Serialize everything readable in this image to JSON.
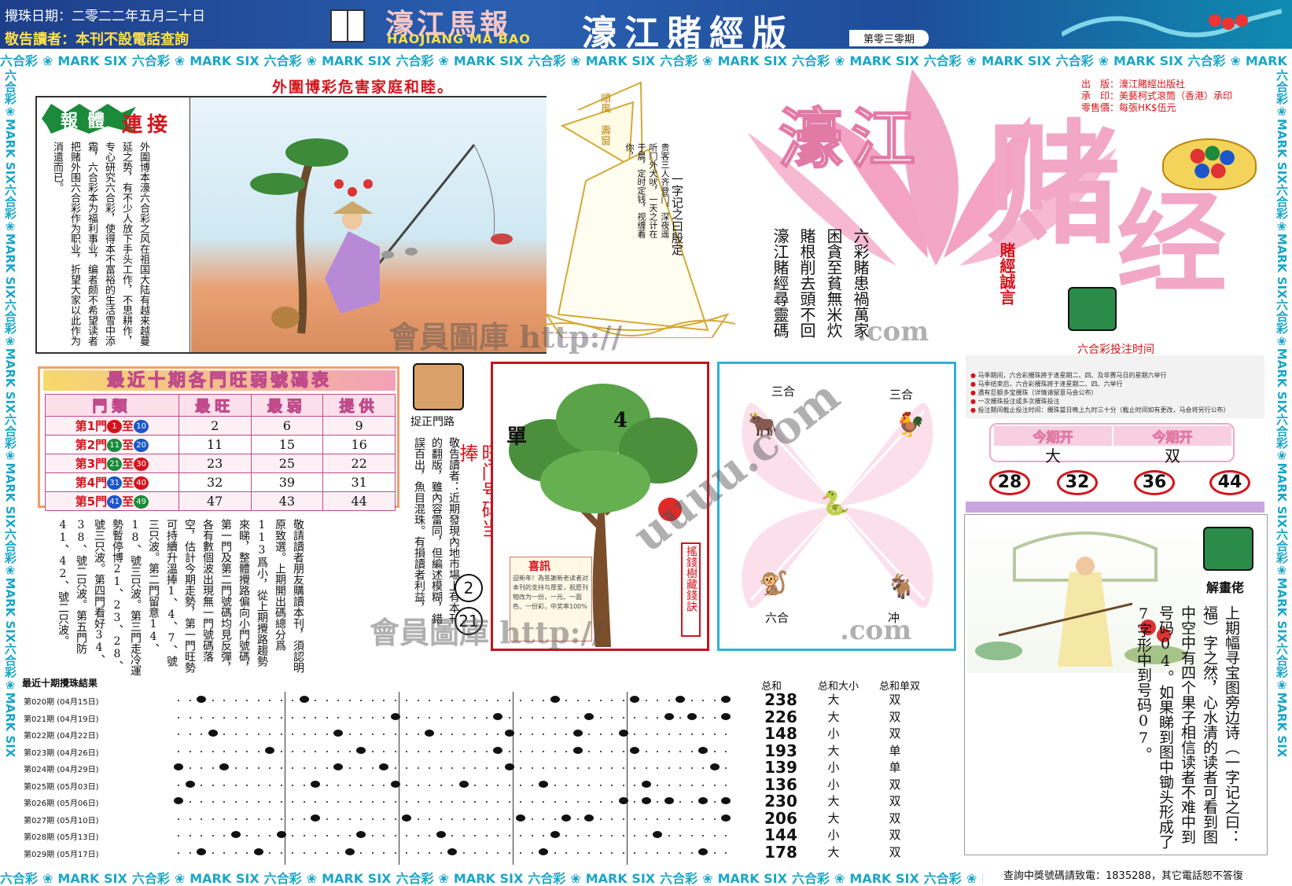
{
  "header": {
    "date": "攪珠日期：二零二二年五月二十日",
    "notice": "敬告讀者：本刊不設電話查詢",
    "logo": "濠江馬報",
    "logo_en": "HAOJIANG MA BAO",
    "edition": "濠江賭經版",
    "issue": "第零三零期"
  },
  "band": {
    "unit_cn": "六合彩",
    "unit_en": "MARK SIX"
  },
  "headline": "外圍博彩危害家庭和睦。",
  "cartoon": {
    "title_a": "報體",
    "title_b": "連接",
    "body": "外圍博本濠六合彩之风在祖国大陆有越来越蔓延之势，有不少人放下手头工作，不思耕作，专心研究六合彩，使得本不富裕的生活雪中添霜，六合彩本为福利事业，编者颇不希望读者把赌外围六合彩作为职业，折望大家以此作为消遣而已。"
  },
  "boat": {
    "sail": "順風\n壽窗",
    "sail_verse": "贵客三人齐登门。深夜遥听门外犬吠，一天之计在于晨，定时定钱，视缠着你，",
    "poem": "一字记之曰殷定"
  },
  "brand": {
    "big1": "濠江",
    "big2": "赌",
    "big3": "经",
    "motto": "賭經誠言",
    "verse": [
      "六彩賭患禍萬家",
      "困貪至貧無米炊",
      "賭根削去頭不回",
      "濠江賭經尋靈碼"
    ],
    "pub_lines": [
      "出　版：濠江賭經出版社",
      "承　印：美藝柯式滾筒（香港）承印",
      "零售價：每張HK$伍元"
    ],
    "schedule_title": "六合彩投注时间"
  },
  "schedule_notes": [
    "马季期间，六合彩攪珠將于逢星期二、四、及非赛马日的星期六举行",
    "马季结束后，六合彩攪珠將于逢星期二、四、六举行",
    "遇有巨额多宝攪珠（详情请留意马会公布）",
    "一次攪珠投注或多次攪珠投注",
    "投注期间截止投注时间：攪珠當日晚上九时三十分（截止时间如有更改，马会将另行公布）"
  ],
  "open": {
    "label": "今期开",
    "left": "大",
    "right": "双",
    "numbers": [
      "28",
      "32",
      "36",
      "44"
    ]
  },
  "ten_table": {
    "title": "最近十期各門旺弱號碼表",
    "headers": [
      "門類",
      "最旺",
      "最弱",
      "提供"
    ],
    "to": "至",
    "rows": [
      {
        "gate": "第1門",
        "from": "1",
        "from_c": "#d4141c",
        "end": "10",
        "end_c": "#1c56c8",
        "hot": "2",
        "cold": "6",
        "pick": "9"
      },
      {
        "gate": "第2門",
        "from": "11",
        "from_c": "#1b8a3a",
        "end": "20",
        "end_c": "#1c56c8",
        "hot": "11",
        "cold": "15",
        "pick": "16"
      },
      {
        "gate": "第3門",
        "from": "21",
        "from_c": "#1b8a3a",
        "end": "30",
        "end_c": "#d4141c",
        "hot": "23",
        "cold": "25",
        "pick": "22"
      },
      {
        "gate": "第4門",
        "from": "31",
        "from_c": "#1c56c8",
        "end": "40",
        "end_c": "#d4141c",
        "hot": "32",
        "cold": "39",
        "pick": "31"
      },
      {
        "gate": "第5門",
        "from": "41",
        "from_c": "#1c56c8",
        "end": "49",
        "end_c": "#1b8a3a",
        "hot": "47",
        "cold": "43",
        "pick": "44"
      }
    ]
  },
  "gate_pick": {
    "label": "捉正門路",
    "note": "敬告讀者：近期發現內地市場上有本刊的翻版，雖內容雷同，但編述模糊，錯誤百出，魚目混珠。有損讀者利益，",
    "title": "旺门号码当捧",
    "n1": "2",
    "n2": "21"
  },
  "analysis": "敬請讀者朋友購讀本刊，須認明原致選。上期開出碼總分爲113爲小，從上期攪路趨勢來睇，整體攪路偏向小門號碼，第一門及第二門號碼均見反彈，各有數個波出現無一門號碼落空，估計今期走勢，第一門旺勢可持續升溫捧1、4、7、號三只波。第二門留意14、18、號三只波。第三門走冷運勢暫停博21、23、28、號三只波。第四門看好34、38、號二只波。第五門防41、42、號二只波。",
  "tree": {
    "single": "單",
    "four": "4",
    "label": "搖錢樹藏錢訣",
    "joy_title": "喜訊",
    "joy_body": "迎新年！為答謝新老读者对本刊的支持与厚爱，祝愿刊物改为一份，一元、一面色、一份彩，中奖率100%"
  },
  "zodiac": {
    "tl": "三合",
    "tr": "三合",
    "bl": "六合",
    "br": "冲"
  },
  "painting": {
    "label": "解畫佬",
    "body": "上期幅寻宝图旁边诗（一字记之曰：福）字之然，心水清的读者可看到图中空中有四个果子相信读者不难中到号码04。如果睇到图中锄头形成了7字形中到号码07。"
  },
  "results": {
    "title": "最近十期攪珠結果",
    "sum_hdr": "总和",
    "size_hdr": "总和大小",
    "oe_hdr": "总和单双",
    "rows": [
      {
        "label": "第020期 (04月15日)",
        "sum": "238",
        "size": "大",
        "oe": "双",
        "dots": [
          3,
          34,
          41,
          45,
          49,
          12
        ]
      },
      {
        "label": "第021期 (04月19日)",
        "sum": "226",
        "size": "大",
        "oe": "双",
        "dots": [
          20,
          29,
          37,
          44,
          46,
          49
        ]
      },
      {
        "label": "第022期 (04月22日)",
        "sum": "148",
        "size": "小",
        "oe": "双",
        "dots": [
          4,
          15,
          23,
          30,
          36,
          40
        ]
      },
      {
        "label": "第023期 (04月26日)",
        "sum": "193",
        "size": "大",
        "oe": "单",
        "dots": [
          9,
          17,
          29,
          36,
          41,
          47
        ]
      },
      {
        "label": "第024期 (04月29日)",
        "sum": "139",
        "size": "小",
        "oe": "单",
        "dots": [
          1,
          5,
          15,
          19,
          30,
          48
        ]
      },
      {
        "label": "第025期 (05月03日)",
        "sum": "136",
        "size": "小",
        "oe": "双",
        "dots": [
          2,
          13,
          20,
          26,
          33,
          42
        ]
      },
      {
        "label": "第026期 (05月06日)",
        "sum": "230",
        "size": "大",
        "oe": "双",
        "dots": [
          1,
          40,
          42,
          44,
          47,
          49
        ]
      },
      {
        "label": "第027期 (05月10日)",
        "sum": "206",
        "size": "大",
        "oe": "双",
        "dots": [
          13,
          21,
          31,
          35,
          37,
          49
        ]
      },
      {
        "label": "第028期 (05月13日)",
        "sum": "144",
        "size": "小",
        "oe": "双",
        "dots": [
          6,
          10,
          17,
          24,
          34,
          43
        ]
      },
      {
        "label": "第029期 (05月17日)",
        "sum": "178",
        "size": "大",
        "oe": "双",
        "dots": [
          3,
          8,
          16,
          25,
          33,
          47
        ]
      }
    ]
  },
  "footer": {
    "phone": "查詢中獎號碼請致電：1835288，其它電話恕不答復"
  },
  "watermark": {
    "a": "會員圖庫 http://",
    "b": ".com",
    "c": "uuuu.com",
    "d": "會員圖庫 http://",
    "e": ".com"
  },
  "colors": {
    "red": "#d4141c",
    "band_cyan": "#1aa6c8",
    "pink": "#f2a7c6",
    "header_blue": "#1d3f8a"
  }
}
